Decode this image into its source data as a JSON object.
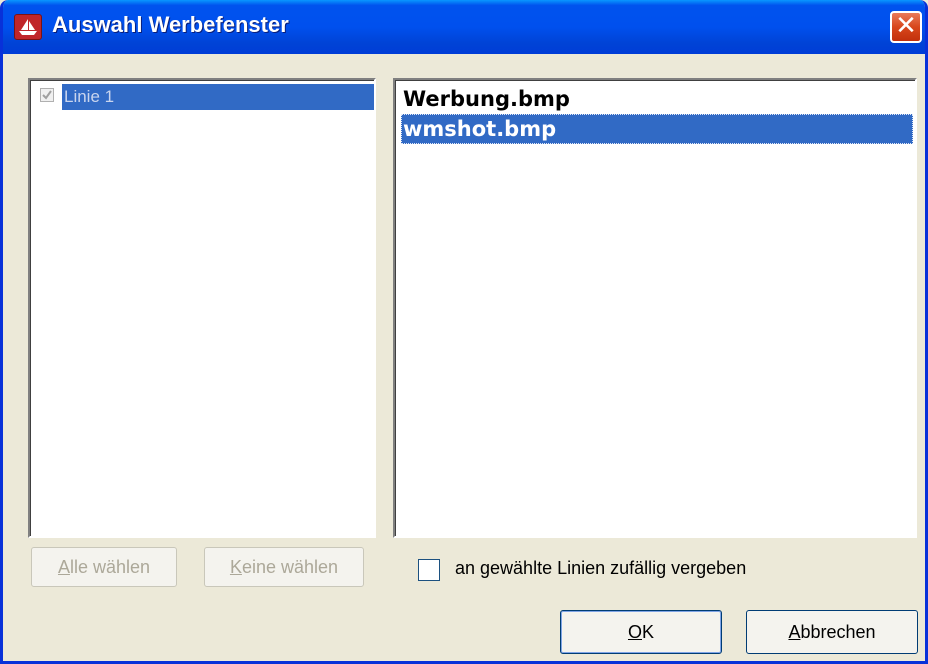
{
  "window": {
    "title": "Auswahl Werbefenster"
  },
  "lines": [
    {
      "label": "Linie 1",
      "checked": true,
      "selected": true
    }
  ],
  "files": [
    {
      "name": "Werbung.bmp",
      "selected": false
    },
    {
      "name": "wmshot.bmp",
      "selected": true
    }
  ],
  "buttons": {
    "select_all": {
      "accel": "A",
      "rest": "lle wählen"
    },
    "select_none": {
      "accel": "K",
      "rest": "eine wählen"
    },
    "ok": {
      "accel": "O",
      "rest": "K"
    },
    "cancel": {
      "accel": "A",
      "rest": "bbrechen"
    }
  },
  "option": {
    "label": "an gewählte Linien zufällig vergeben",
    "checked": false
  },
  "colors": {
    "titlebar": "#0054e3",
    "selection": "#316ac5",
    "dialog_bg": "#ece9d8",
    "close": "#d8471c"
  }
}
